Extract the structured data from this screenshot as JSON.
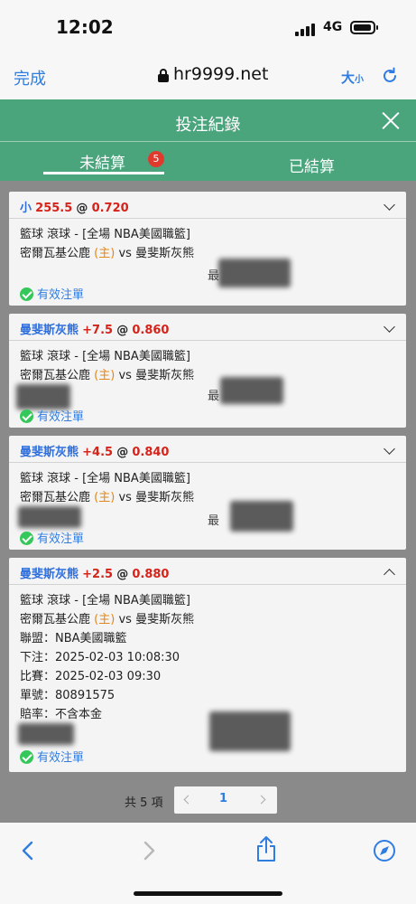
{
  "status": {
    "time": "12:02",
    "network": "4G"
  },
  "browser": {
    "done_label": "完成",
    "url": "hr9999.net",
    "text_size_big": "大",
    "text_size_small": "小"
  },
  "modal": {
    "title": "投注紀錄"
  },
  "tabs": {
    "unsettled": "未結算",
    "unsettled_count": "5",
    "settled": "已結算"
  },
  "colors": {
    "header_green": "#4aa57d",
    "link_blue": "#2f7de1",
    "odds_red": "#d5231a",
    "home_orange": "#e2871a",
    "badge_red": "#e03a2e"
  },
  "bets": [
    {
      "selection": "小",
      "handicap": "255.5",
      "at": "@",
      "odds": "0.720",
      "sport_line": "籃球 滾球 - [全場 NBA美國職籃]",
      "home_team": "密爾瓦基公鹿",
      "home_tag": "(主)",
      "vs": "vs",
      "away_team": "曼斐斯灰熊",
      "fragment": "最",
      "valid": "有效注單"
    },
    {
      "selection": "曼斐斯灰熊",
      "handicap": "+7.5",
      "at": "@",
      "odds": "0.860",
      "sport_line": "籃球 滾球 - [全場 NBA美國職籃]",
      "home_team": "密爾瓦基公鹿",
      "home_tag": "(主)",
      "vs": "vs",
      "away_team": "曼斐斯灰熊",
      "fragment": "最",
      "valid": "有效注單"
    },
    {
      "selection": "曼斐斯灰熊",
      "handicap": "+4.5",
      "at": "@",
      "odds": "0.840",
      "sport_line": "籃球 滾球 - [全場 NBA美國職籃]",
      "home_team": "密爾瓦基公鹿",
      "home_tag": "(主)",
      "vs": "vs",
      "away_team": "曼斐斯灰熊",
      "fragment": "最",
      "valid": "有效注單"
    },
    {
      "selection": "曼斐斯灰熊",
      "handicap": "+2.5",
      "at": "@",
      "odds": "0.880",
      "sport_line": "籃球 滾球 - [全場 NBA美國職籃]",
      "home_team": "密爾瓦基公鹿",
      "home_tag": "(主)",
      "vs": "vs",
      "away_team": "曼斐斯灰熊",
      "league": "聯盟：NBA美國職籃",
      "bet_time": "下注：2025-02-03 10:08:30",
      "match_time": "比賽：2025-02-03 09:30",
      "ticket": "單號：80891575",
      "odds_type": "賠率：不含本金",
      "valid": "有效注單"
    }
  ],
  "pagination": {
    "total": "共 5 項",
    "page": "1"
  }
}
